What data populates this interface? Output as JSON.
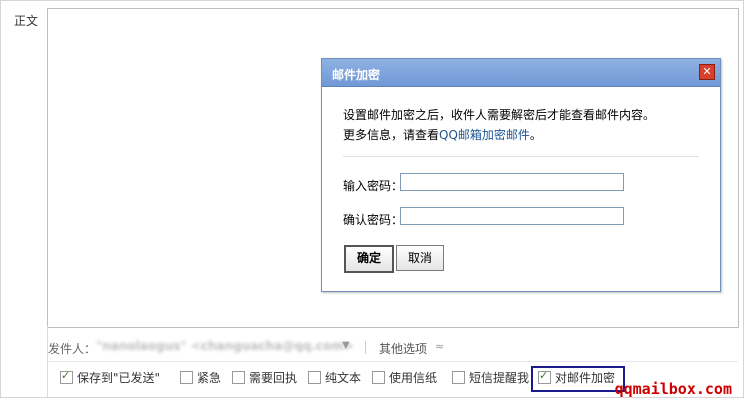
{
  "body_label": "正文",
  "dialog": {
    "title": "邮件加密",
    "close_glyph": "✕",
    "line1": "设置邮件加密之后，收件人需要解密后才能查看邮件内容。",
    "line2_prefix": "更多信息，请查看",
    "line2_link": "QQ邮箱加密邮件",
    "line2_suffix": "。",
    "password_label": "输入密码：",
    "confirm_label": "确认密码：",
    "password_value": "",
    "confirm_value": "",
    "ok_label": "确定",
    "cancel_label": "取消"
  },
  "sender": {
    "label": "发件人：",
    "value": "\"nanolaogus\" <changuacha@qq.com>",
    "dropdown_glyph": "▼",
    "more_options": "其他选项",
    "more_icon": "≈"
  },
  "options": [
    {
      "label": "保存到\"已发送\"",
      "checked": true
    },
    {
      "label": "紧急",
      "checked": false
    },
    {
      "label": "需要回执",
      "checked": false
    },
    {
      "label": "纯文本",
      "checked": false
    },
    {
      "label": "使用信纸",
      "checked": false
    },
    {
      "label": "短信提醒我",
      "checked": false
    },
    {
      "label": "对邮件加密",
      "checked": true
    }
  ],
  "watermark": "qqmailbox.com",
  "colors": {
    "accent": "#7199d6",
    "link": "#1e5494",
    "highlight_box": "#1a1a8c",
    "watermark": "#cc0000"
  }
}
